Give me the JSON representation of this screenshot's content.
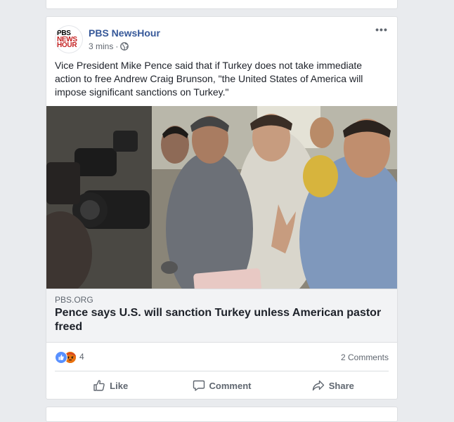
{
  "post": {
    "page_name": "PBS NewsHour",
    "avatar_lines": [
      "PBS",
      "NEWS",
      "HOUR"
    ],
    "timestamp": "3 mins",
    "separator": "·",
    "audience_icon": "globe-icon",
    "more_label": "•••",
    "text": "Vice President Mike Pence said that if Turkey does not take immediate action to free Andrew Craig Brunson, \"the United States of America will impose significant sanctions on Turkey.\"",
    "link": {
      "domain": "PBS.ORG",
      "headline": "Pence says U.S. will sanction Turkey unless American pastor freed"
    },
    "reactions": {
      "types": [
        "like",
        "angry"
      ],
      "count": "4"
    },
    "comments_count": "2 Comments",
    "actions": {
      "like": "Like",
      "comment": "Comment",
      "share": "Share"
    }
  },
  "colors": {
    "page_background": "#e9ebee",
    "link_blue": "#365899",
    "secondary_text": "#606770",
    "like_blue": "#5890ff",
    "angry_orange": "#f0a335"
  }
}
